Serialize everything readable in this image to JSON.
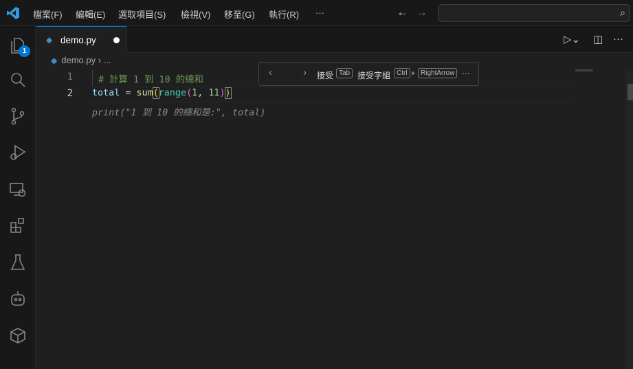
{
  "menu": [
    "檔案(F)",
    "編輯(E)",
    "選取項目(S)",
    "檢視(V)",
    "移至(G)",
    "執行(R)",
    "···"
  ],
  "activity": {
    "explorer_badge": "1",
    "items": [
      "explorer-icon",
      "search-icon",
      "source-control-icon",
      "run-debug-icon",
      "remote-explorer-icon",
      "extensions-icon",
      "testing-icon",
      "copilot-icon",
      "containers-icon"
    ]
  },
  "tab": {
    "name": "demo.py",
    "modified": true
  },
  "breadcrumb": {
    "file": "demo.py",
    "sep": "›",
    "more": "..."
  },
  "lines": {
    "n1": "1",
    "n2": "2",
    "l1": "# 計算 1 到 10 的總和",
    "l2": {
      "var": "total",
      "op": " = ",
      "fn": "sum",
      "p1": "(",
      "cls": "range",
      "p2": "(",
      "n1": "1",
      "comma": ", ",
      "n2": "11",
      "p3": ")",
      "p4": ")"
    },
    "ghost": "print(\"1 到 10 的總和是:\", total)"
  },
  "inline_suggest": {
    "prev": "‹",
    "next": "›",
    "accept": "接受",
    "accept_key": "Tab",
    "accept_word": "接受字組",
    "ctrl": "Ctrl",
    "plus": "+",
    "arrow": "RightArrow",
    "more": "···"
  },
  "colors": {
    "accent": "#0078d4",
    "comment": "#6a9955",
    "variable": "#9cdcfe",
    "function": "#dcdcaa",
    "class": "#4ec9b0"
  }
}
